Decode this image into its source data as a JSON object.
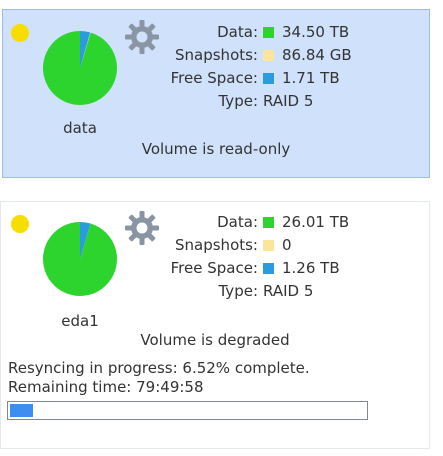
{
  "colors": {
    "data": "#2ed42e",
    "snapshots": "#fae59a",
    "free_space": "#2b9be0",
    "status_dot": "#f7dd00",
    "progress": "#3d8ef0"
  },
  "labels": {
    "data": "Data:",
    "snapshots": "Snapshots:",
    "free_space": "Free Space:",
    "type": "Type:"
  },
  "volumes": [
    {
      "name": "data",
      "data": "34.50 TB",
      "snapshots": "86.84 GB",
      "free_space": "1.71 TB",
      "type": "RAID 5",
      "status": "Volume is read-only",
      "used_fraction": 0.953,
      "snapshot_fraction": 0.002,
      "free_fraction": 0.045
    },
    {
      "name": "eda1",
      "data": "26.01 TB",
      "snapshots": "0",
      "free_space": "1.26 TB",
      "type": "RAID 5",
      "status": "Volume is degraded",
      "used_fraction": 0.954,
      "snapshot_fraction": 0.0,
      "free_fraction": 0.046,
      "resync_text": "Resyncing in progress: 6.52% complete.",
      "remaining_text": "Remaining time: 79:49:58",
      "progress_fraction": 0.0652
    }
  ]
}
